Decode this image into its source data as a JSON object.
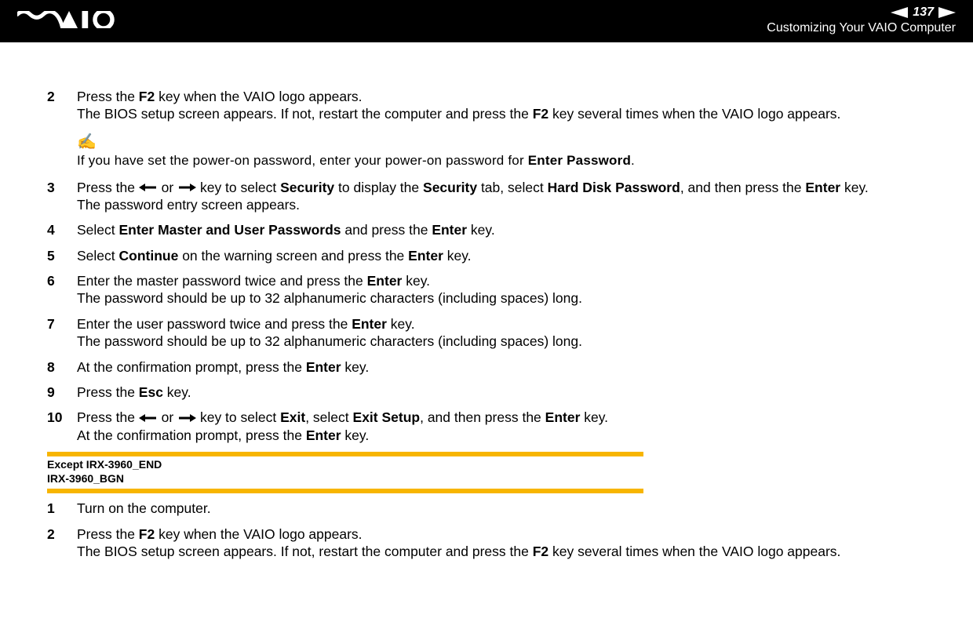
{
  "header": {
    "page_number": "137",
    "section_title": "Customizing Your VAIO Computer"
  },
  "first_block": {
    "steps": [
      {
        "n": "2",
        "runs": [
          {
            "t": "Press the "
          },
          {
            "t": "F2",
            "b": true
          },
          {
            "t": " key when the VAIO logo appears."
          },
          {
            "br": true
          },
          {
            "t": "The BIOS setup screen appears. If not, restart the computer and press the "
          },
          {
            "t": "F2",
            "b": true
          },
          {
            "t": " key several times when the VAIO logo appears."
          }
        ]
      },
      {
        "note": true,
        "runs": [
          {
            "t": "If you have set the power-on password, enter your power-on password for "
          },
          {
            "t": "Enter Password",
            "b": true,
            "cond": true
          },
          {
            "t": "."
          }
        ]
      },
      {
        "n": "3",
        "runs": [
          {
            "t": "Press the "
          },
          {
            "arrow": "left"
          },
          {
            "t": " or "
          },
          {
            "arrow": "right"
          },
          {
            "t": " key to select "
          },
          {
            "t": "Security",
            "b": true
          },
          {
            "t": " to display the "
          },
          {
            "t": "Security",
            "b": true
          },
          {
            "t": " tab, select "
          },
          {
            "t": "Hard Disk Password",
            "b": true
          },
          {
            "t": ", and then press the "
          },
          {
            "t": "Enter",
            "b": true
          },
          {
            "t": " key."
          },
          {
            "br": true
          },
          {
            "t": "The password entry screen appears."
          }
        ]
      },
      {
        "n": "4",
        "runs": [
          {
            "t": "Select "
          },
          {
            "t": "Enter Master and User Passwords",
            "b": true
          },
          {
            "t": " and press the "
          },
          {
            "t": "Enter",
            "b": true
          },
          {
            "t": " key."
          }
        ]
      },
      {
        "n": "5",
        "runs": [
          {
            "t": "Select "
          },
          {
            "t": "Continue",
            "b": true
          },
          {
            "t": " on the warning screen and press the "
          },
          {
            "t": "Enter",
            "b": true
          },
          {
            "t": " key."
          }
        ]
      },
      {
        "n": "6",
        "runs": [
          {
            "t": "Enter the master password twice and press the "
          },
          {
            "t": "Enter",
            "b": true
          },
          {
            "t": " key."
          },
          {
            "br": true
          },
          {
            "t": "The password should be up to 32 alphanumeric characters (including spaces) long."
          }
        ]
      },
      {
        "n": "7",
        "runs": [
          {
            "t": "Enter the user password twice and press the "
          },
          {
            "t": "Enter",
            "b": true
          },
          {
            "t": " key."
          },
          {
            "br": true
          },
          {
            "t": "The password should be up to 32 alphanumeric characters (including spaces) long."
          }
        ]
      },
      {
        "n": "8",
        "runs": [
          {
            "t": "At the confirmation prompt, press the "
          },
          {
            "t": "Enter",
            "b": true
          },
          {
            "t": " key."
          }
        ]
      },
      {
        "n": "9",
        "runs": [
          {
            "t": "Press the "
          },
          {
            "t": "Esc",
            "b": true
          },
          {
            "t": " key."
          }
        ]
      },
      {
        "n": "10",
        "runs": [
          {
            "t": "Press the "
          },
          {
            "arrow": "left"
          },
          {
            "t": " or "
          },
          {
            "arrow": "right"
          },
          {
            "t": " key to select "
          },
          {
            "t": "Exit",
            "b": true
          },
          {
            "t": ", select "
          },
          {
            "t": "Exit Setup",
            "b": true
          },
          {
            "t": ", and then press the "
          },
          {
            "t": "Enter",
            "b": true
          },
          {
            "t": " key."
          },
          {
            "br": true
          },
          {
            "t": "At the confirmation prompt, press the "
          },
          {
            "t": "Enter",
            "b": true
          },
          {
            "t": " key."
          }
        ]
      }
    ]
  },
  "marker": {
    "line1": "Except IRX-3960_END",
    "line2": "IRX-3960_BGN"
  },
  "second_block": {
    "steps": [
      {
        "n": "1",
        "runs": [
          {
            "t": "Turn on the computer."
          }
        ]
      },
      {
        "n": "2",
        "runs": [
          {
            "t": "Press the "
          },
          {
            "t": "F2",
            "b": true
          },
          {
            "t": " key when the VAIO logo appears."
          },
          {
            "br": true
          },
          {
            "t": "The BIOS setup screen appears. If not, restart the computer and press the "
          },
          {
            "t": "F2",
            "b": true
          },
          {
            "t": " key several times when the VAIO logo appears."
          }
        ]
      }
    ]
  }
}
